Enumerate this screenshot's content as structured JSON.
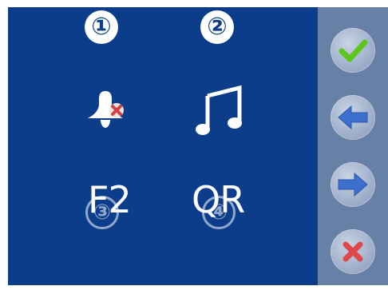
{
  "options": [
    {
      "number": "①",
      "icon": "bell-muted-icon"
    },
    {
      "number": "②",
      "icon": "music-note-icon"
    },
    {
      "number": "③",
      "label": "F2"
    },
    {
      "number": "④",
      "label": "QR"
    }
  ],
  "sidebar": {
    "buttons": [
      {
        "name": "confirm-button",
        "icon": "checkmark-icon"
      },
      {
        "name": "back-button",
        "icon": "arrow-left-icon"
      },
      {
        "name": "forward-button",
        "icon": "arrow-right-icon"
      },
      {
        "name": "cancel-button",
        "icon": "close-icon"
      }
    ]
  },
  "colors": {
    "background": "#0c3d8b",
    "sidebar": "#6780a6",
    "check": "#5cc61a",
    "arrow": "#3d6fce",
    "close": "#e0474a"
  }
}
